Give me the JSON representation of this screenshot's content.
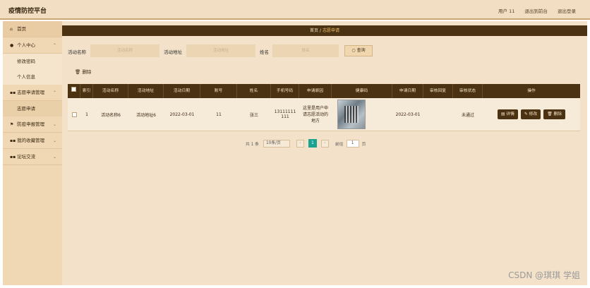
{
  "header": {
    "title": "疫情防控平台",
    "user": "用户 11",
    "back_link": "退出到前台",
    "logout": "退出登录"
  },
  "sidebar": {
    "items": [
      {
        "label": "首页",
        "icon": "home-icon"
      },
      {
        "label": "个人中心",
        "icon": "user-icon",
        "children": [
          "修改密码",
          "个人信息"
        ]
      },
      {
        "label": "志愿申请管理",
        "icon": "grid-icon",
        "children": [
          "志愿申请"
        ]
      },
      {
        "label": "防疫申报管理",
        "icon": "flag-icon"
      },
      {
        "label": "我的收藏管理",
        "icon": "grid-icon"
      },
      {
        "label": "论坛交流",
        "icon": "grid-icon"
      }
    ]
  },
  "breadcrumb": {
    "home": "首页",
    "sep": "/",
    "current": "志愿申请"
  },
  "search": {
    "activity_name_label": "活动名称",
    "activity_name_placeholder": "活动名称",
    "activity_addr_label": "活动地址",
    "activity_addr_placeholder": "活动地址",
    "name_label": "姓名",
    "name_placeholder": "姓名",
    "button": "查询"
  },
  "toolbar": {
    "delete_label": "删除"
  },
  "table": {
    "columns": [
      "索引",
      "活动名称",
      "活动地址",
      "活动日期",
      "账号",
      "姓名",
      "手机号码",
      "申请原因",
      "健康码",
      "申请日期",
      "审核回复",
      "审核状态",
      "操作"
    ],
    "rows": [
      {
        "index": "1",
        "activity_name": "活动名称6",
        "activity_addr": "活动地址6",
        "activity_date": "2022-03-01",
        "account": "11",
        "name": "张三",
        "phone": "13111111111",
        "reason": "这里是用户申请志愿活动的地方",
        "apply_date": "2022-03-01",
        "reply": "",
        "status": "未通过",
        "actions": {
          "detail": "详情",
          "edit": "修改",
          "delete": "删除"
        }
      }
    ]
  },
  "pager": {
    "total": "共 1 条",
    "page_size": "10条/页",
    "current": "1",
    "goto_label": "前往",
    "goto_value": "1",
    "page_unit": "页"
  },
  "watermark": "CSDN @琪琪 学姐"
}
